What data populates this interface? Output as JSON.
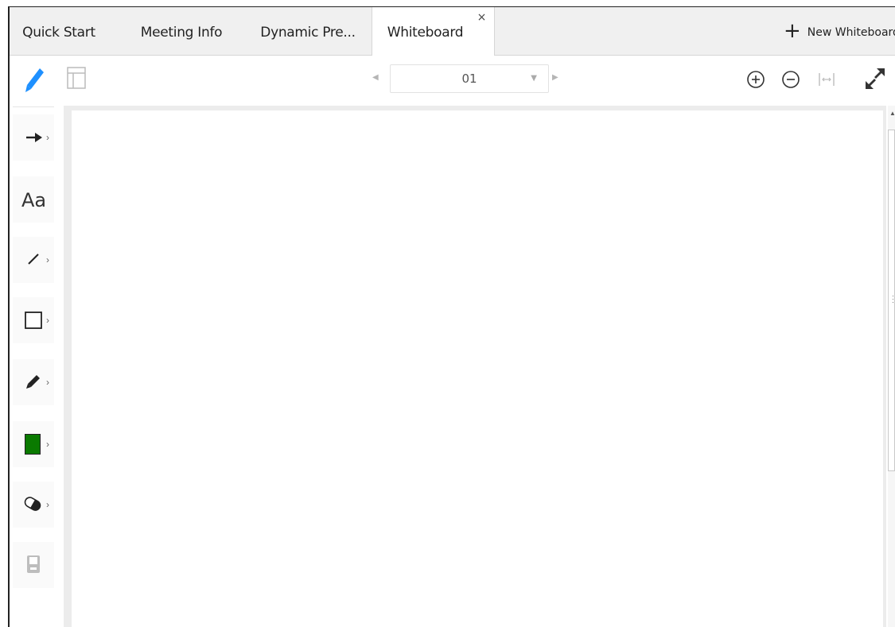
{
  "tabs": [
    {
      "label": "Quick Start",
      "active": false
    },
    {
      "label": "Meeting Info",
      "active": false
    },
    {
      "label": "Dynamic Pre...",
      "active": false
    },
    {
      "label": "Whiteboard",
      "active": true
    }
  ],
  "tab_close": "×",
  "new_whiteboard_label": "New Whiteboard",
  "toolbar": {
    "page_value": "01",
    "page_caret": "▼",
    "prev_arrow": "◀",
    "next_arrow": "▶"
  },
  "left_tools": {
    "chevron": "›",
    "text_label": "Aa",
    "fill_color": "#0a7a00"
  },
  "colors": {
    "accent_blue": "#1e90ff",
    "tab_bar_bg": "#f0f0f0",
    "canvas_bg": "#ffffff"
  }
}
